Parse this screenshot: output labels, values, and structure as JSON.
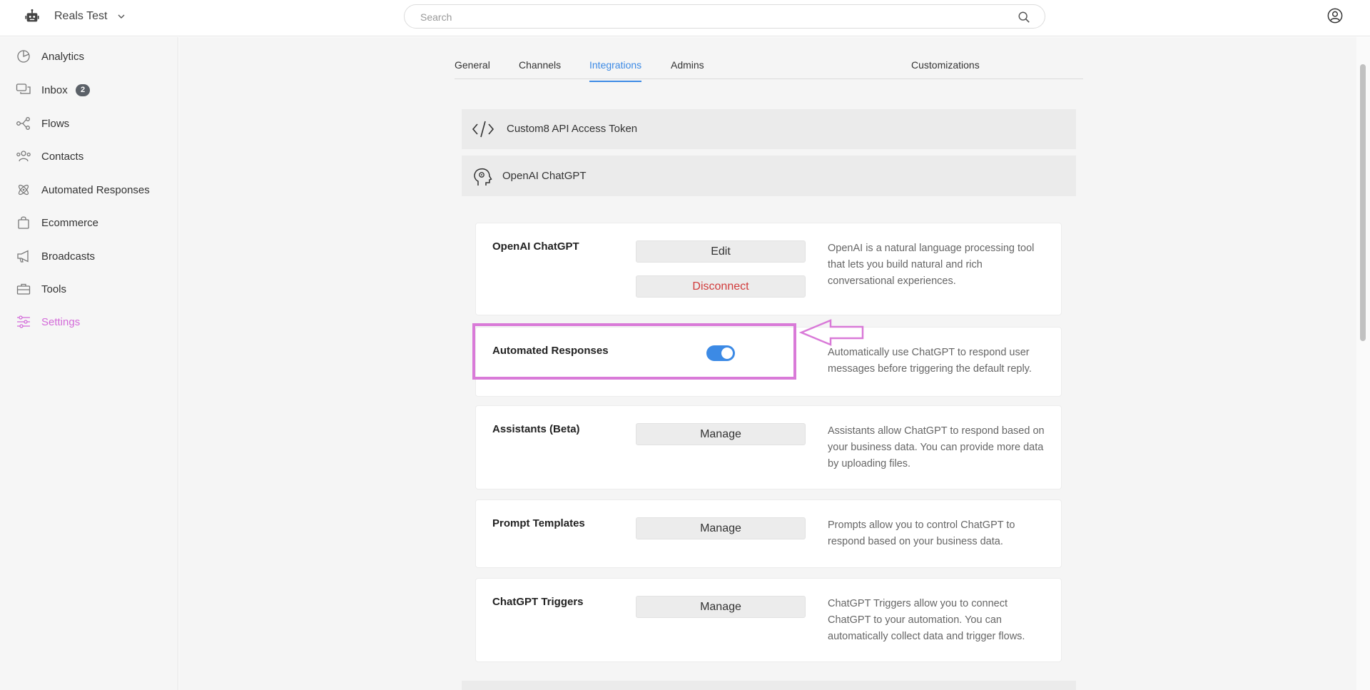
{
  "workspace": {
    "name": "Reals Test",
    "icon": "robot-icon",
    "dropdown_icon": "chevron-down-icon"
  },
  "search": {
    "placeholder": "Search",
    "value": ""
  },
  "sidebar": {
    "items": [
      {
        "label": "Analytics",
        "icon": "pie-chart-icon"
      },
      {
        "label": "Inbox",
        "icon": "chat-bubbles-icon",
        "badge": "2"
      },
      {
        "label": "Flows",
        "icon": "flow-nodes-icon"
      },
      {
        "label": "Contacts",
        "icon": "contacts-icon"
      },
      {
        "label": "Automated Responses",
        "icon": "atom-icon"
      },
      {
        "label": "Ecommerce",
        "icon": "shopping-bag-icon"
      },
      {
        "label": "Broadcasts",
        "icon": "megaphone-icon"
      },
      {
        "label": "Tools",
        "icon": "toolbox-icon"
      },
      {
        "label": "Settings",
        "icon": "sliders-icon",
        "active": true
      }
    ]
  },
  "tabs": [
    {
      "label": "General"
    },
    {
      "label": "Channels"
    },
    {
      "label": "Integrations",
      "active": true
    },
    {
      "label": "Admins"
    },
    {
      "label": "Customizations"
    }
  ],
  "integrations": [
    {
      "label": "Custom8 API Access Token",
      "icon": "code-icon"
    },
    {
      "label": "OpenAI ChatGPT",
      "icon": "ai-head-icon"
    }
  ],
  "cards": {
    "openai": {
      "title": "OpenAI ChatGPT",
      "edit_label": "Edit",
      "disconnect_label": "Disconnect",
      "description": "OpenAI is a natural language processing tool that lets you build natural and rich conversational experiences."
    },
    "automated": {
      "title": "Automated Responses",
      "toggle_on": true,
      "description": "Automatically use ChatGPT to respond user messages before triggering the default reply."
    },
    "assistants": {
      "title": "Assistants (Beta)",
      "button_label": "Manage",
      "description": "Assistants allow ChatGPT to respond based on your business data. You can provide more data by uploading files."
    },
    "prompts": {
      "title": "Prompt Templates",
      "button_label": "Manage",
      "description": "Prompts allow you to control ChatGPT to respond based on your business data."
    },
    "triggers": {
      "title": "ChatGPT Triggers",
      "button_label": "Manage",
      "description": "ChatGPT Triggers allow you to connect ChatGPT to your automation. You can automatically collect data and trigger flows."
    }
  },
  "colors": {
    "accent": "#3c8ae5",
    "active_nav": "#d36ad9",
    "highlight": "#d97ad8",
    "danger": "#d13b3b"
  }
}
